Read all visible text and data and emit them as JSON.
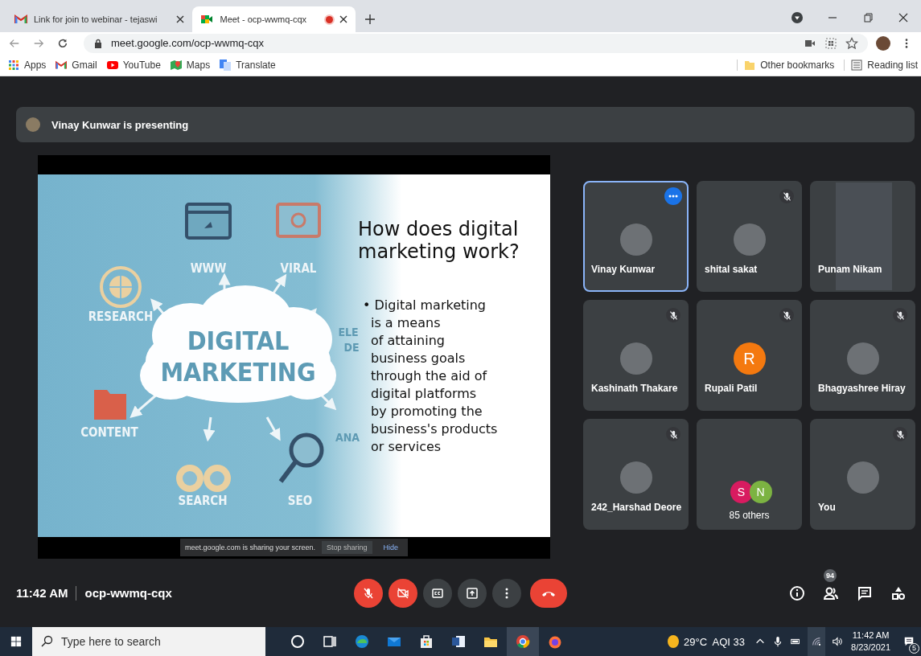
{
  "browser": {
    "tabs": [
      {
        "title": "Link for join to webinar - tejaswi",
        "kind": "gmail",
        "selected": false,
        "recording": false
      },
      {
        "title": "Meet - ocp-wwmq-cqx",
        "kind": "meet",
        "selected": true,
        "recording": true
      }
    ],
    "url": "meet.google.com/ocp-wwmq-cqx",
    "bookmarks": [
      {
        "label": "Apps",
        "kind": "apps"
      },
      {
        "label": "Gmail",
        "kind": "gmail"
      },
      {
        "label": "YouTube",
        "kind": "youtube"
      },
      {
        "label": "Maps",
        "kind": "maps"
      },
      {
        "label": "Translate",
        "kind": "translate"
      }
    ],
    "bookmarks_right": [
      {
        "label": "Other bookmarks",
        "kind": "folder"
      },
      {
        "label": "Reading list",
        "kind": "list"
      }
    ]
  },
  "meet": {
    "presenting_banner": "Vinay Kunwar is presenting",
    "slide": {
      "heading": "How does digital\nmarketing work?",
      "body": "• Digital marketing\nis a means\nof attaining\nbusiness goals\nthrough the aid of\ndigital platforms\nby promoting the\nbusiness's products\nor services",
      "labels": [
        "WWW",
        "VIRAL",
        "RESEARCH",
        "DIGITAL",
        "MARKETING",
        "CONTENT",
        "SEARCH",
        "SEO",
        "ELE",
        "DE",
        "ANA"
      ]
    },
    "share_notice": {
      "message": "meet.google.com is sharing your screen.",
      "stop": "Stop sharing",
      "hide": "Hide"
    },
    "tiles": [
      {
        "kind": "avatar",
        "name": "Vinay Kunwar",
        "muted": false,
        "highlighted": true,
        "options_shown": true
      },
      {
        "kind": "avatar",
        "name": "shital sakat",
        "muted": true,
        "highlighted": false,
        "options_shown": false
      },
      {
        "kind": "video",
        "name": "Punam Nikam",
        "muted": false,
        "highlighted": false,
        "options_shown": false
      },
      {
        "kind": "avatar",
        "name": "Kashinath Thakare",
        "muted": true,
        "highlighted": false,
        "options_shown": false
      },
      {
        "kind": "initial",
        "name": "Rupali Patil",
        "muted": true,
        "highlighted": false,
        "options_shown": false,
        "initials": [
          {
            "letter": "R",
            "color": "#f4790f"
          }
        ]
      },
      {
        "kind": "avatar",
        "name": "Bhagyashree Hiray",
        "muted": true,
        "highlighted": false,
        "options_shown": false
      },
      {
        "kind": "avatar",
        "name": "242_Harshad Deore",
        "muted": true,
        "highlighted": false,
        "options_shown": false
      },
      {
        "kind": "others",
        "name": "85 others",
        "muted": false,
        "highlighted": false,
        "options_shown": false,
        "initials": [
          {
            "letter": "S",
            "color": "#d81b60"
          },
          {
            "letter": "N",
            "color": "#7cb342"
          }
        ]
      },
      {
        "kind": "avatar",
        "name": "You",
        "muted": true,
        "highlighted": false,
        "options_shown": false
      }
    ],
    "time": "11:42 AM",
    "meeting_code": "ocp-wwmq-cqx",
    "controls": {
      "mic_on": false,
      "camera_on": false
    },
    "people_count": "94"
  },
  "taskbar": {
    "search_placeholder": "Type here to search",
    "apps": [
      {
        "kind": "cortana",
        "active": false
      },
      {
        "kind": "taskview",
        "active": false
      },
      {
        "kind": "edge",
        "active": false
      },
      {
        "kind": "mail",
        "active": false
      },
      {
        "kind": "store",
        "active": false
      },
      {
        "kind": "word",
        "active": false
      },
      {
        "kind": "explorer",
        "active": false
      },
      {
        "kind": "chrome",
        "active": true
      },
      {
        "kind": "firefox",
        "active": false
      }
    ],
    "weather": "29°C  AQI 33",
    "time": "11:42 AM",
    "date": "8/23/2021",
    "notifications": "5"
  }
}
